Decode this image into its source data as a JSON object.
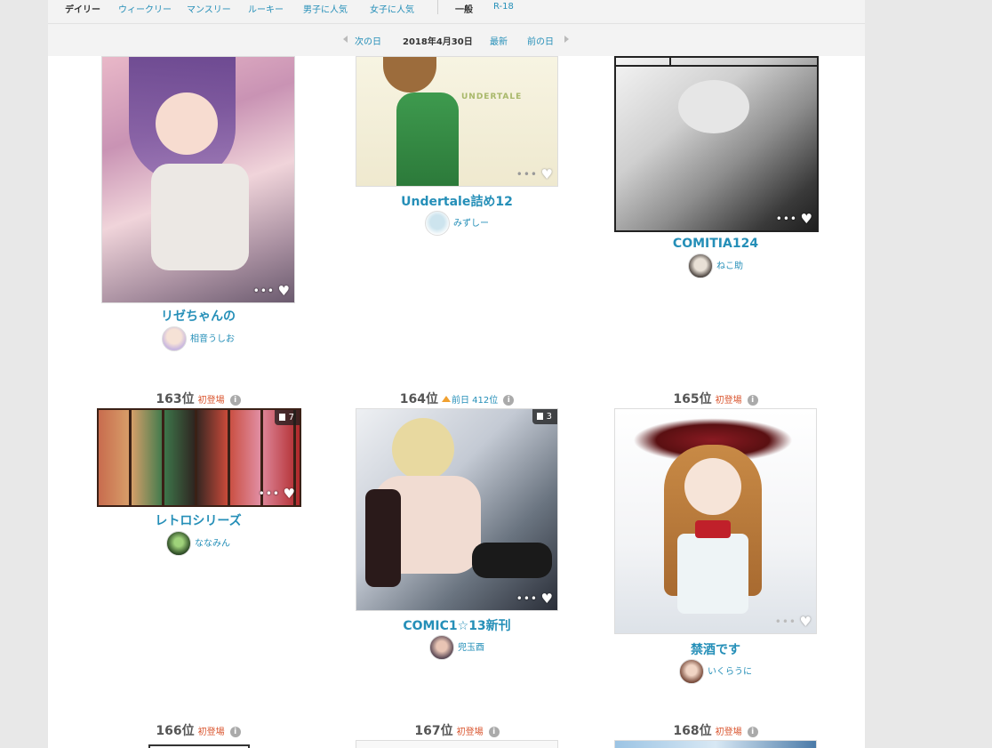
{
  "nav": {
    "items": [
      {
        "label": "デイリー",
        "active": true
      },
      {
        "label": "ウィークリー",
        "active": false
      },
      {
        "label": "マンスリー",
        "active": false
      },
      {
        "label": "ルーキー",
        "active": false
      },
      {
        "label": "男子に人気",
        "active": false
      },
      {
        "label": "女子に人気",
        "active": false
      },
      {
        "label": "一般",
        "active": true
      },
      {
        "label": "R-18",
        "active": false
      }
    ]
  },
  "datebar": {
    "next_day": "次の日",
    "current_date": "2018年4月30日",
    "latest": "最新",
    "prev_day": "前の日"
  },
  "cards": [
    {
      "title": "リゼちゃんの",
      "author": "相音うしお"
    },
    {
      "title": "Undertale詰め12",
      "author": "みずしー"
    },
    {
      "title": "COMITIA124",
      "author": "ねこ助"
    },
    {
      "rank": "163位",
      "status": "初登場",
      "title": "レトロシリーズ",
      "author": "ななみん",
      "pages": "7"
    },
    {
      "rank": "164位",
      "status": "前日 412位",
      "title": "COMIC1☆13新刊",
      "author": "兜玉酉",
      "pages": "3"
    },
    {
      "rank": "165位",
      "status": "初登場",
      "title": "禁酒です",
      "author": "いくらうに"
    },
    {
      "rank": "166位",
      "status": "初登場"
    },
    {
      "rank": "167位",
      "status": "初登場"
    },
    {
      "rank": "168位",
      "status": "初登場"
    }
  ],
  "icons": {
    "more": "more-dots-icon",
    "like": "heart-icon",
    "info": "info-icon",
    "pages": "multi-page-icon"
  },
  "colors": {
    "link": "#258fb8",
    "status_new": "#d9532c",
    "rank_up_arrow": "#f0a030"
  }
}
